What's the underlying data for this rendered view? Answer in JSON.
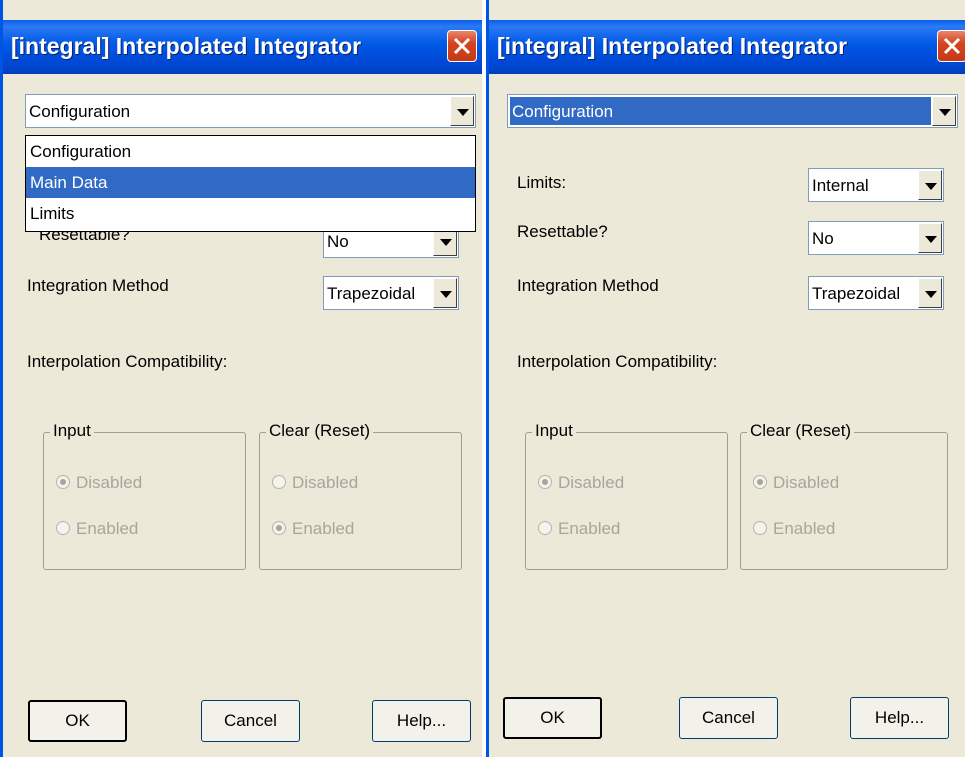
{
  "left_dialog": {
    "title": "[integral] Interpolated Integrator",
    "page_select": "Configuration",
    "dropdown_options": [
      "Configuration",
      "Main Data",
      "Limits"
    ],
    "highlighted_option": "Main Data",
    "resettable_label": "Resettable?",
    "resettable_value": "No",
    "method_label": "Integration Method",
    "method_value": "Trapezoidal",
    "interp_label": "Interpolation Compatibility:",
    "input_group": {
      "label": "Input",
      "disabled": "Disabled",
      "enabled": "Enabled",
      "selected": "Disabled"
    },
    "clear_group": {
      "label": "Clear (Reset)",
      "disabled": "Disabled",
      "enabled": "Enabled",
      "selected": "Enabled"
    },
    "buttons": {
      "ok": "OK",
      "cancel": "Cancel",
      "help": "Help..."
    }
  },
  "right_dialog": {
    "title": "[integral] Interpolated Integrator",
    "page_select": "Configuration",
    "limits_label": "Limits:",
    "limits_value": "Internal",
    "resettable_label": "Resettable?",
    "resettable_value": "No",
    "method_label": "Integration Method",
    "method_value": "Trapezoidal",
    "interp_label": "Interpolation Compatibility:",
    "input_group": {
      "label": "Input",
      "disabled": "Disabled",
      "enabled": "Enabled",
      "selected": "Disabled"
    },
    "clear_group": {
      "label": "Clear (Reset)",
      "disabled": "Disabled",
      "enabled": "Enabled",
      "selected": "Disabled"
    },
    "buttons": {
      "ok": "OK",
      "cancel": "Cancel",
      "help": "Help..."
    }
  },
  "icons": {
    "close": "close-icon",
    "dropdown": "chevron-down-icon",
    "radio": "radio-icon"
  },
  "colors": {
    "titlebar": "#0054e3",
    "close_button": "#d5441f",
    "selection": "#316ac5",
    "dialog_face": "#ece9d8"
  }
}
